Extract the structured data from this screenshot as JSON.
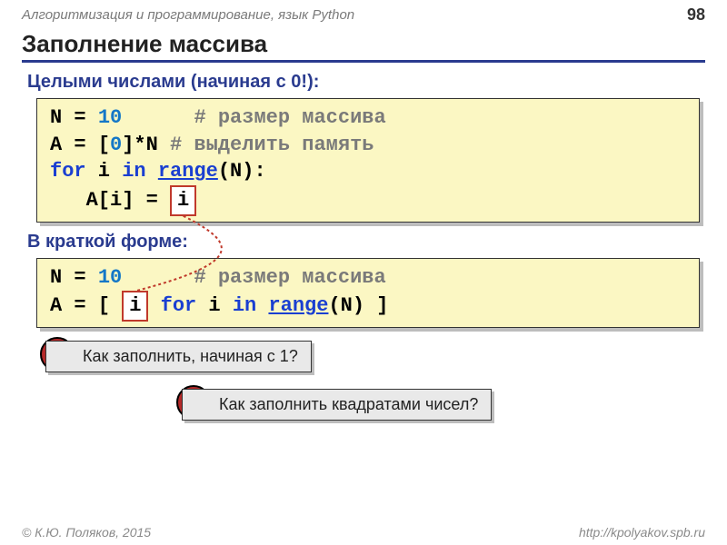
{
  "header": {
    "course": "Алгоритмизация и программирование, язык Python",
    "page": "98"
  },
  "title": "Заполнение массива",
  "section1": "Целыми числами (начиная с 0!):",
  "code1": {
    "l1a": "N = ",
    "l1n": "10",
    "l1c": "# размер массива",
    "l2a": "A = [",
    "l2n": "0",
    "l2b": "]*N  ",
    "l2c": "# выделить память",
    "l3a": "for",
    "l3b": " i ",
    "l3c": "in",
    "l3d": " ",
    "l3fn": "range",
    "l3e": "(N):",
    "l4a": "   A[i] = ",
    "l4box": "i"
  },
  "section2": "В краткой форме:",
  "code2": {
    "l1a": "N = ",
    "l1n": "10",
    "l1c": "# размер массива",
    "l2a": "A = [ ",
    "l2box": "i",
    "l2b": " ",
    "l2for": "for",
    "l2c": " i ",
    "l2in": "in",
    "l2d": " ",
    "l2fn": "range",
    "l2e": "(N) ]"
  },
  "q1": "Как заполнить, начиная с 1?",
  "q2": "Как заполнить квадратами чисел?",
  "qmark": "?",
  "footer": {
    "left": "© К.Ю. Поляков, 2015",
    "right": "http://kpolyakov.spb.ru"
  }
}
